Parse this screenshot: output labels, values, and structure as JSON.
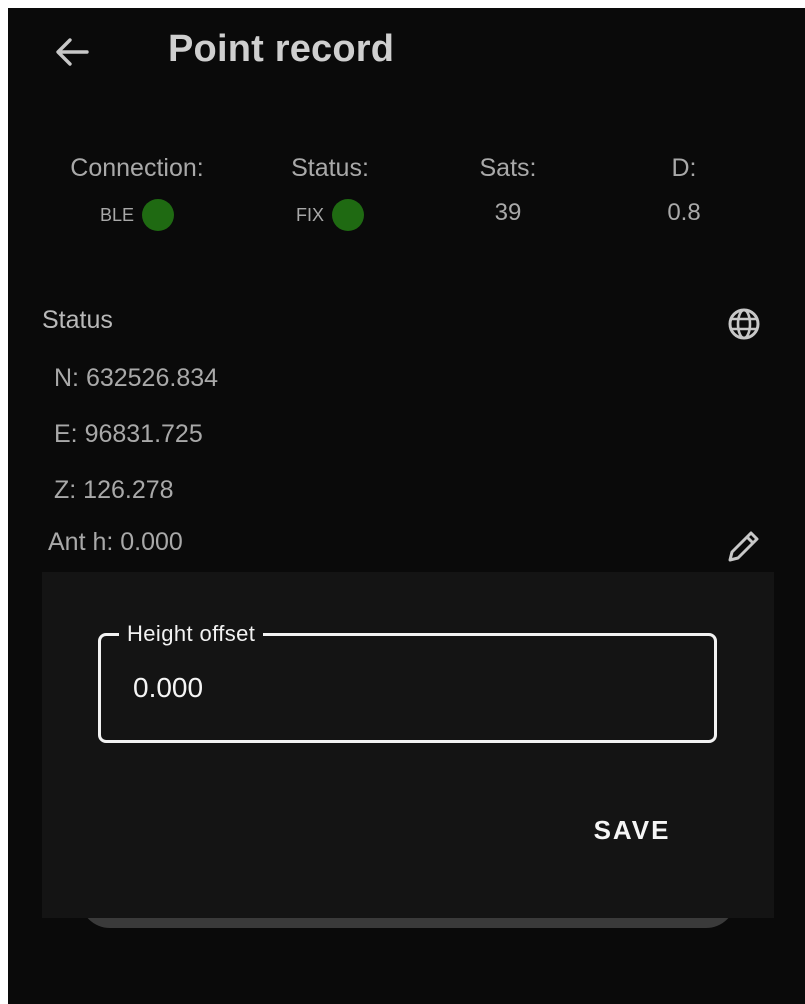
{
  "app_bar": {
    "title": "Point record",
    "back_icon": "arrow-left-icon"
  },
  "info": {
    "connection": {
      "label": "Connection:",
      "value": "BLE",
      "indicator_color": "#1f6a12"
    },
    "status": {
      "label": "Status:",
      "value": "FIX",
      "indicator_color": "#1f6a12"
    },
    "sats": {
      "label": "Sats:",
      "value": "39"
    },
    "d": {
      "label": "D:",
      "value": "0.8"
    }
  },
  "status_section": {
    "title": "Status",
    "globe_icon": "globe-icon",
    "coords": {
      "n": "N: 632526.834",
      "e": "E: 96831.725",
      "z": "Z: 126.278",
      "ant_h": "Ant h: 0.000"
    },
    "edit_icon": "pencil-icon"
  },
  "dialog": {
    "field_label": "Height offset",
    "field_value": "0.000",
    "save_label": "SAVE"
  }
}
